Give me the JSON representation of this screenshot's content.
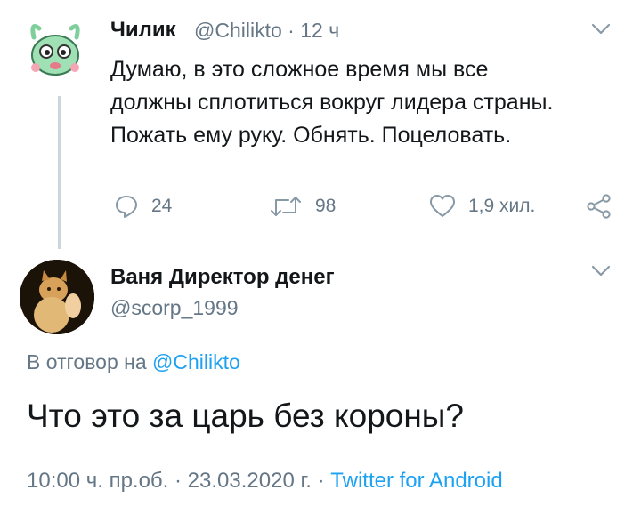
{
  "tweet": {
    "author_name": "Чилик",
    "author_handle": "@Chilikto",
    "separator": "·",
    "time": "12 ч",
    "text": "Думаю, в это сложное время мы все должны сплотиться вокруг лидера страны. Пожать ему руку. Обнять. Поцеловать.",
    "actions": {
      "reply_icon": "reply-icon",
      "reply_count": "24",
      "retweet_icon": "retweet-icon",
      "retweet_count": "98",
      "like_icon": "heart-icon",
      "like_count": "1,9 хил.",
      "share_icon": "share-icon"
    }
  },
  "reply": {
    "author_name": "Ваня Директор денег",
    "author_handle": "@scorp_1999",
    "reply_prefix": "В отговор на",
    "reply_mention": "@Chilikto",
    "text": "Что это за царь без короны?",
    "datetime": "10:00 ч. пр.об. · 23.03.2020 г. ·",
    "source": "Twitter for Android"
  },
  "colors": {
    "secondary_text": "#657786",
    "link": "#1da1f2",
    "thread_line": "#ccd6dd"
  }
}
